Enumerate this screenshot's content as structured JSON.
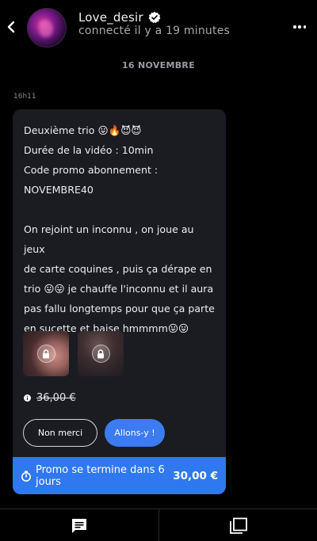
{
  "header": {
    "username": "Love_desir",
    "status": "connecté il y a 19 minutes",
    "back_icon": "chevron-left-icon",
    "verified_icon": "verified-badge-icon",
    "more_icon": "more-horizontal-icon"
  },
  "conversation": {
    "date_separator": "16 NOVEMBRE",
    "message_time": "16h11"
  },
  "message": {
    "lines_1": [
      "Deuxième trio 😛🔥😈😈",
      "Durée de la vidéo : 10min",
      "Code promo abonnement :",
      "NOVEMBRE40"
    ],
    "lines_2": [
      "On rejoint un inconnu , on joue au jeux",
      "de carte coquines , puis ça dérape en",
      "trio 😛😛 je chauffe l'inconnu et il aura",
      "pas fallu longtemps pour que ça parte",
      "en sucette et baise hmmmm😛😛"
    ],
    "media": [
      {
        "locked": true,
        "icon": "lock-icon"
      },
      {
        "locked": true,
        "icon": "lock-icon"
      }
    ],
    "old_price": "36,00 €",
    "buttons": {
      "decline": "Non merci",
      "accept": "Allons-y !"
    },
    "promo": {
      "text": "Promo se termine dans 6 jours",
      "price": "30,00 €",
      "icon": "timer-icon"
    }
  },
  "tabbar": {
    "tabs": [
      {
        "icon": "messages-icon"
      },
      {
        "icon": "gallery-icon"
      }
    ]
  },
  "colors": {
    "background": "#000000",
    "card": "#1b1c22",
    "accent": "#3b7cf3",
    "promo": "#2f78f0"
  }
}
